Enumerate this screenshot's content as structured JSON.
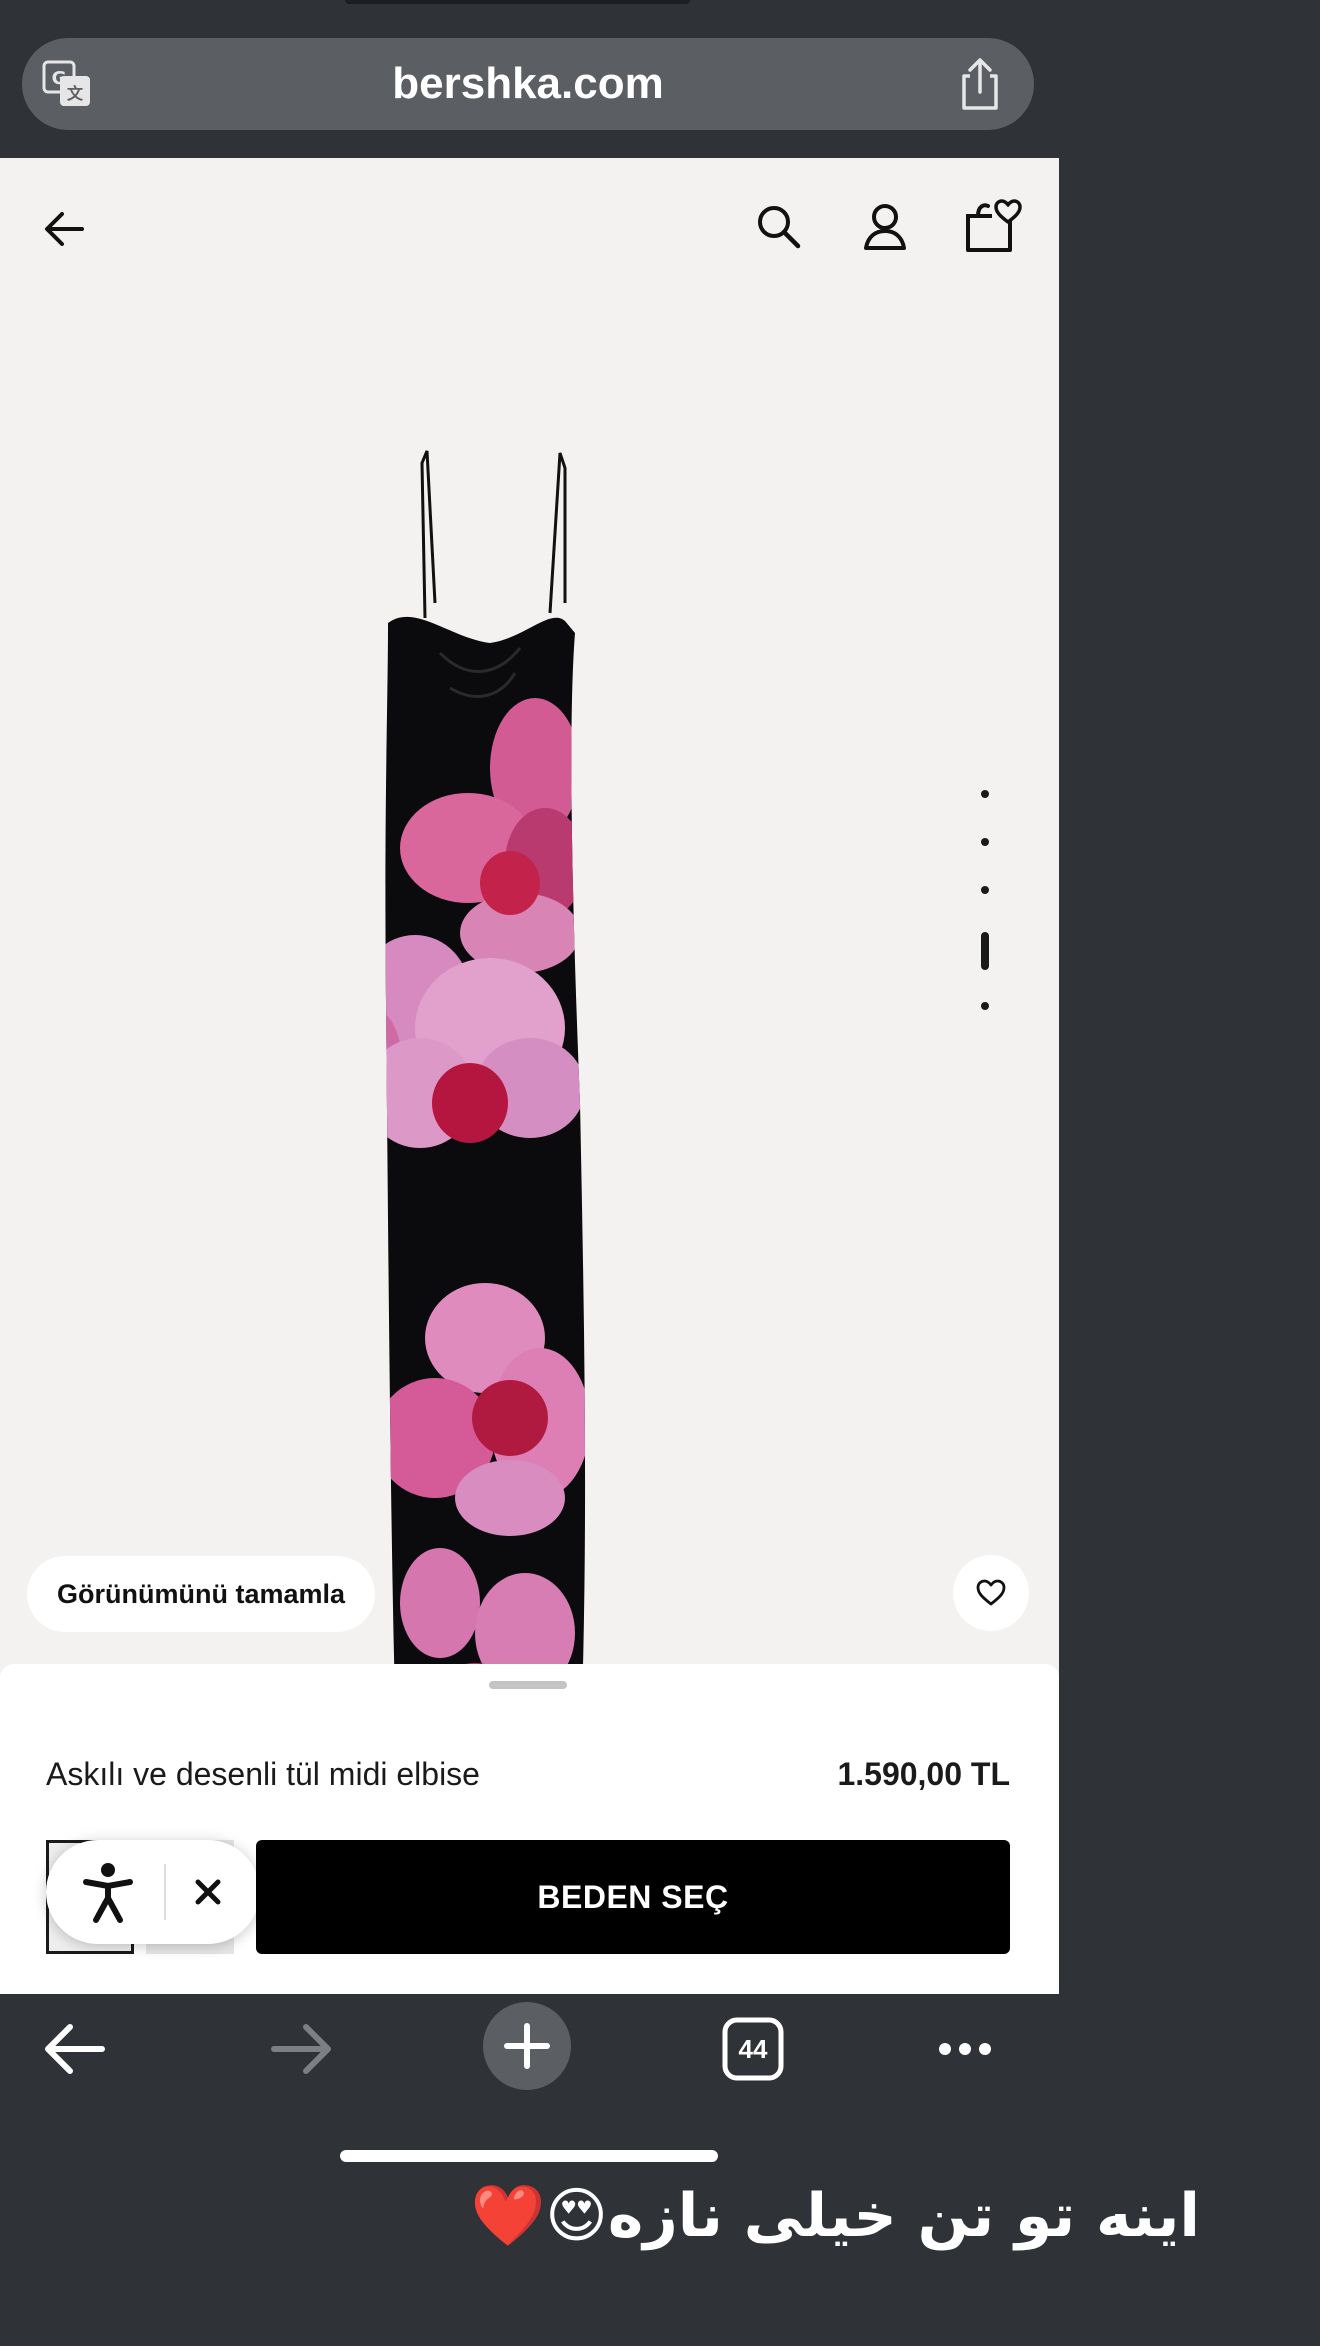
{
  "browser": {
    "url": "bershka.com",
    "open_tabs_count": "44"
  },
  "product": {
    "complete_look_label": "Görünümünü tamamla",
    "name": "Askılı ve desenli tül midi elbise",
    "price": "1.590,00 TL",
    "select_size_label": "BEDEN SEÇ",
    "gallery": {
      "image_count": 5,
      "current_image": 4
    }
  },
  "overlay": {
    "caption": "اینه تو تن خیلی نازه😍❤️"
  },
  "colors": {
    "browser_chrome": "#2f3237",
    "url_bar": "#5b5e63",
    "page_bg": "#f3f2f0",
    "primary_button": "#000000"
  },
  "icons": {
    "header": [
      "back-arrow-icon",
      "search-icon",
      "account-icon",
      "shopping-bag-heart-icon"
    ],
    "toolbar": [
      "back-icon",
      "forward-icon",
      "new-tab-plus-icon",
      "tabs-icon",
      "more-icon"
    ]
  }
}
